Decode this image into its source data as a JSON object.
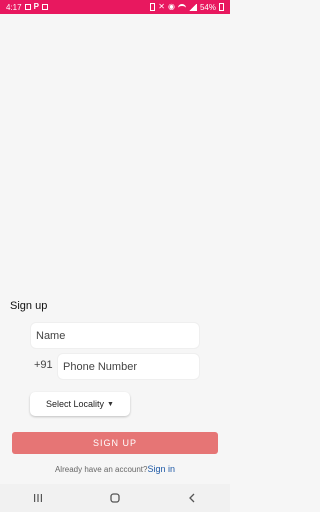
{
  "status_bar": {
    "time": "4:17",
    "battery": "54%",
    "left_icons": [
      "notification-icon",
      "p-icon",
      "image-icon"
    ],
    "right_icons": [
      "battery-saver-icon",
      "mute-icon",
      "hotspot-icon",
      "wifi-icon",
      "signal-icon",
      "battery-icon"
    ]
  },
  "form": {
    "title": "Sign up",
    "name_placeholder": "Name",
    "country_code": "+91",
    "phone_placeholder": "Phone Number",
    "locality_label": "Select Locality",
    "signup_label": "SIGN UP"
  },
  "footer": {
    "account_prompt": "Already have an account?",
    "signin_label": "Sign in"
  },
  "nav_bar": {
    "buttons": [
      "recent-apps-icon",
      "home-icon",
      "back-icon"
    ]
  },
  "colors": {
    "status_bar": "#e8185f",
    "signup_button": "#e67575",
    "link": "#1f5aa6",
    "background": "#f6f6f6"
  }
}
